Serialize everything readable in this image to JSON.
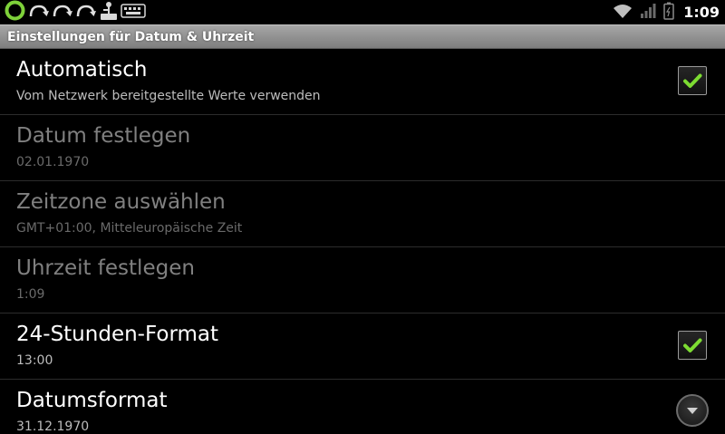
{
  "status_bar": {
    "clock": "1:09",
    "left_icons": [
      "sync-ring-icon",
      "redo-arrow-icon",
      "redo-arrow-icon",
      "redo-arrow-icon",
      "usb-debug-icon",
      "keyboard-icon"
    ],
    "right_icons": [
      "wifi-icon",
      "signal-bars-icon",
      "battery-icon"
    ]
  },
  "header": {
    "title": "Einstellungen für Datum & Uhrzeit"
  },
  "settings": [
    {
      "title": "Automatisch",
      "summary": "Vom Netzwerk bereitgestellte Werte verwenden",
      "enabled": true,
      "widget": "checkbox",
      "checked": true
    },
    {
      "title": "Datum festlegen",
      "summary": "02.01.1970",
      "enabled": false,
      "widget": "none"
    },
    {
      "title": "Zeitzone auswählen",
      "summary": "GMT+01:00, Mitteleuropäische Zeit",
      "enabled": false,
      "widget": "none"
    },
    {
      "title": "Uhrzeit festlegen",
      "summary": "1:09",
      "enabled": false,
      "widget": "none"
    },
    {
      "title": "24-Stunden-Format",
      "summary": "13:00",
      "enabled": true,
      "widget": "checkbox",
      "checked": true
    },
    {
      "title": "Datumsformat",
      "summary": "31.12.1970",
      "enabled": true,
      "widget": "dropdown"
    }
  ],
  "colors": {
    "check_green": "#7ddc32",
    "ring_green": "#7ed13a",
    "background": "#000000"
  }
}
